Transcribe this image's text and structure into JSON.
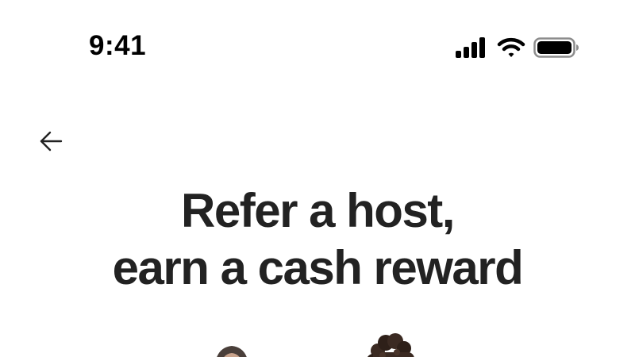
{
  "status_bar": {
    "time": "9:41",
    "icons": [
      "signal-icon",
      "wifi-icon",
      "battery-icon"
    ]
  },
  "nav": {
    "back_icon": "arrow-left-icon"
  },
  "headline": {
    "line1": "Refer a host,",
    "line2": "earn a cash reward"
  },
  "colors": {
    "text": "#222222",
    "background": "#ffffff",
    "status_icons": "#000000"
  }
}
